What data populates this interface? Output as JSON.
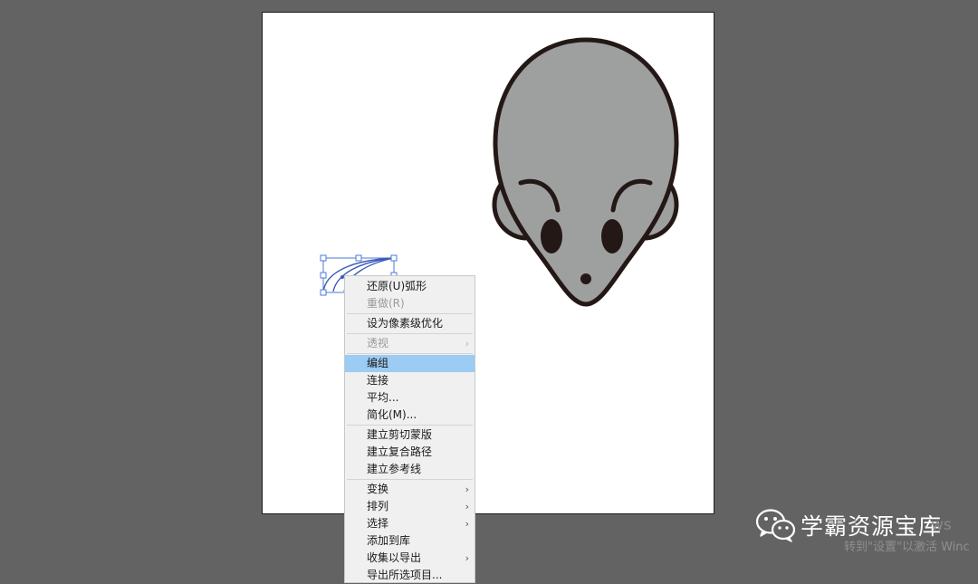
{
  "menu": {
    "items": [
      {
        "label": "还原(U)弧形",
        "disabled": false,
        "submenu": false
      },
      {
        "label": "重做(R)",
        "disabled": true,
        "submenu": false
      },
      {
        "sep": true
      },
      {
        "label": "设为像素级优化",
        "disabled": false,
        "submenu": false
      },
      {
        "sep": true
      },
      {
        "label": "透视",
        "disabled": true,
        "submenu": true
      },
      {
        "sep": true
      },
      {
        "label": "编组",
        "disabled": false,
        "submenu": false,
        "highlighted": true
      },
      {
        "label": "连接",
        "disabled": false,
        "submenu": false
      },
      {
        "label": "平均...",
        "disabled": false,
        "submenu": false
      },
      {
        "label": "简化(M)...",
        "disabled": false,
        "submenu": false
      },
      {
        "sep": true
      },
      {
        "label": "建立剪切蒙版",
        "disabled": false,
        "submenu": false
      },
      {
        "label": "建立复合路径",
        "disabled": false,
        "submenu": false
      },
      {
        "label": "建立参考线",
        "disabled": false,
        "submenu": false
      },
      {
        "sep": true
      },
      {
        "label": "变换",
        "disabled": false,
        "submenu": true
      },
      {
        "label": "排列",
        "disabled": false,
        "submenu": true
      },
      {
        "label": "选择",
        "disabled": false,
        "submenu": true
      },
      {
        "label": "添加到库",
        "disabled": false,
        "submenu": false
      },
      {
        "label": "收集以导出",
        "disabled": false,
        "submenu": true
      },
      {
        "label": "导出所选项目...",
        "disabled": false,
        "submenu": false
      }
    ]
  },
  "watermark": {
    "brand": "学霸资源宝库",
    "icon": "wechat-icon"
  },
  "windows_activation": {
    "suffix": "ws",
    "line2": "转到\"设置\"以激活 Winc"
  },
  "colors": {
    "workspace": "#636363",
    "mouse_fill": "#9ea09f",
    "mouse_stroke": "#231815",
    "selection": "#4a78d8",
    "menu_highlight": "#9ccbf3"
  }
}
